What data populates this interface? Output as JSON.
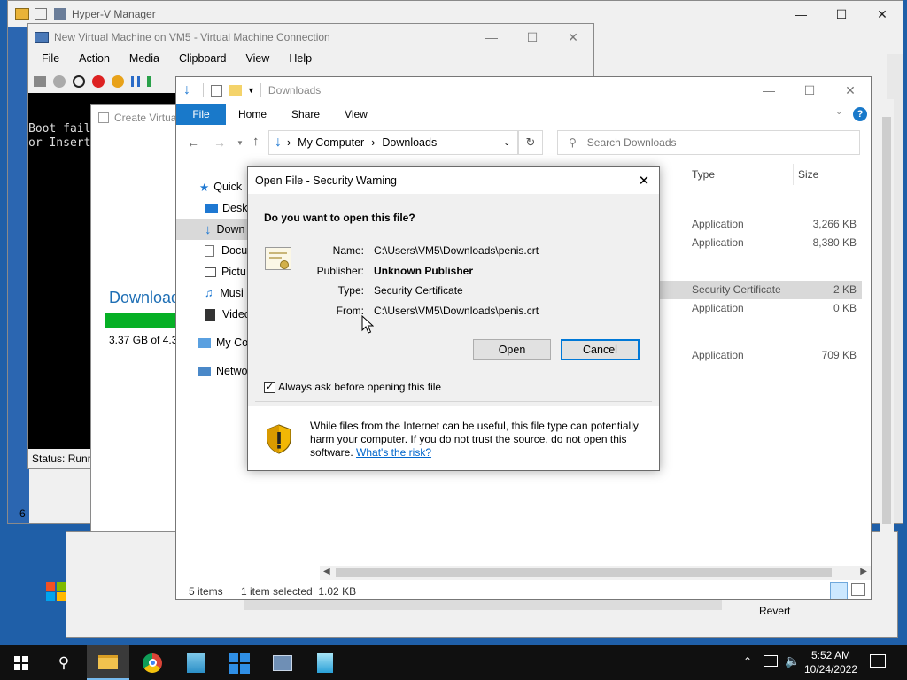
{
  "hyperv": {
    "title": "Hyper-V Manager"
  },
  "vmconn": {
    "title": "New Virtual Machine on VM5 - Virtual Machine Connection",
    "menu": [
      "File",
      "Action",
      "Media",
      "Clipboard",
      "View",
      "Help"
    ],
    "console_lines": [
      "Boot fail",
      "or Insert"
    ],
    "status": "Status: Runn"
  },
  "create_vm": {
    "title": "Create Virtual",
    "download_text": "Download",
    "download_size": "3.37 GB of 4.36",
    "progress_pct": 85
  },
  "explorer": {
    "title": "Downloads",
    "ribbon_tabs": [
      "File",
      "Home",
      "Share",
      "View"
    ],
    "breadcrumb": [
      "My Computer",
      "Downloads"
    ],
    "search_placeholder": "Search Downloads",
    "nav": [
      "Quick",
      "Deskt",
      "Down",
      "Docu",
      "Pictu",
      "Musi",
      "Video",
      "My Co",
      "Netwo"
    ],
    "columns": {
      "type": "Type",
      "size": "Size"
    },
    "files": [
      {
        "type": "Application",
        "size": "3,266 KB"
      },
      {
        "type": "Application",
        "size": "8,380 KB"
      },
      {
        "type": "Security Certificate",
        "size": "2 KB"
      },
      {
        "type": "Application",
        "size": "0 KB"
      },
      {
        "type": "Application",
        "size": "709 KB"
      }
    ],
    "status_items": "5 items",
    "status_selected": "1 item selected  1.02 KB"
  },
  "dialog": {
    "title": "Open File - Security Warning",
    "question": "Do you want to open this file?",
    "name_label": "Name:",
    "name_value": "C:\\Users\\VM5\\Downloads\\penis.crt",
    "publisher_label": "Publisher:",
    "publisher_value": "Unknown Publisher",
    "type_label": "Type:",
    "type_value": "Security Certificate",
    "from_label": "From:",
    "from_value": "C:\\Users\\VM5\\Downloads\\penis.crt",
    "open_label": "Open",
    "cancel_label": "Cancel",
    "always_ask": "Always ask before opening this file",
    "always_ask_checked": true,
    "warning": "While files from the Internet can be useful, this file type can potentially harm your computer. If you do not trust the source, do not open this software.",
    "risk_link": "What's the risk?"
  },
  "background_misc": {
    "revert": "Revert",
    "left_digit": "6"
  },
  "taskbar": {
    "time": "5:52 AM",
    "date": "10/24/2022"
  },
  "colors": {
    "accent": "#0078d7",
    "taskbar": "#101010",
    "selection": "#cce8ff"
  }
}
